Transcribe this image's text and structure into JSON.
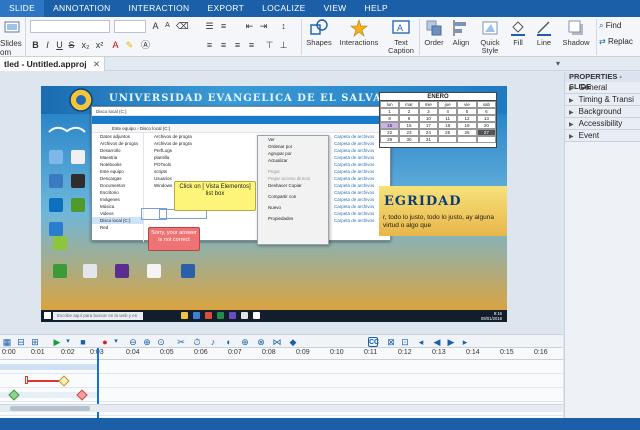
{
  "menu": [
    "SLIDE",
    "ANNOTATION",
    "INTERACTION",
    "EXPORT",
    "LOCALIZE",
    "VIEW",
    "HELP"
  ],
  "ribbon": {
    "left_label": "Slides\nom",
    "tools": {
      "shapes": "Shapes",
      "interactions": "Interactions",
      "text_caption_1": "Text",
      "text_caption_2": "Caption",
      "order": "Order",
      "align": "Align",
      "quick_style_1": "Quick",
      "quick_style_2": "Style",
      "fill": "Fill",
      "line": "Line",
      "shadow": "Shadow",
      "find": "Find",
      "replace": "Replac"
    }
  },
  "document_tab": {
    "title": "tled - Untitled.approj",
    "close": "✕"
  },
  "slide": {
    "banner_title": "UNIVERSIDAD EVANGELICA DE EL SALVADOR",
    "explorer": {
      "title": "Disco local (C:)",
      "address": "Este equipo › Disco local (C:)",
      "sidebar": [
        "Datos adjuntos",
        "Archivos de progra",
        "Desarrollo",
        "Maestria",
        "Notebooks",
        "Este equipo",
        "Descargas",
        "Documentos",
        "Escritorio",
        "Imágenes",
        "Música",
        "Videos",
        "Disco local (C:)",
        "Red"
      ],
      "list": [
        "Archivos de progra",
        "Archivos de progra",
        "PerfLogs",
        "plantilla",
        "POTools",
        "scripts",
        "Usuarios",
        "Windows"
      ],
      "context_menu": [
        "Ver",
        "Ordenar por",
        "Agrupar por",
        "Actualizar",
        "Pegar",
        "Pegar acceso directo",
        "Deshacer Copiar",
        "Compartir con",
        "Nuevo",
        "Propiedades"
      ],
      "context_menu_dim": [
        false,
        false,
        false,
        false,
        true,
        true,
        false,
        false,
        false,
        false
      ],
      "right_col": [
        "Carpeta de archivos",
        "Carpeta de archivos",
        "Carpeta de archivos",
        "Carpeta de archivos",
        "Carpeta de archivos",
        "Carpeta de archivos",
        "Carpeta de archivos",
        "Carpeta de archivos",
        "Carpeta de archivos",
        "Carpeta de archivos",
        "Carpeta de archivos",
        "Carpeta de archivos",
        "Carpeta de archivos"
      ]
    },
    "hint_callout": "Click on [ Vista Elementos] list box",
    "fail_callout": "Sorry, your answer is not correct",
    "calendar": {
      "month": "ENERO",
      "days": [
        "lun",
        "mar",
        "mie",
        "jue",
        "vie",
        "sab"
      ],
      "rows": [
        [
          "1",
          "2",
          "3",
          "4",
          "5",
          "6"
        ],
        [
          "8",
          "9",
          "10",
          "11",
          "12",
          "13"
        ],
        [
          "15",
          "16",
          "17",
          "18",
          "19",
          "20"
        ],
        [
          "22",
          "23",
          "24",
          "25",
          "26",
          "27"
        ],
        [
          "29",
          "30",
          "31",
          "",
          "",
          ""
        ]
      ]
    },
    "values_word": "EGRIDAD",
    "values_text": "r, todo lo justo, todo lo justo, ay alguna virtud o algo que",
    "taskbar_search": "Escribe aquí para buscar en la web y en Windows",
    "clock_time": "9:16",
    "clock_date": "08/01/2018"
  },
  "properties": {
    "title": "PROPERTIES - SLIDE",
    "items": [
      "General",
      "Timing & Transi",
      "Background",
      "Accessibility",
      "Event"
    ]
  },
  "timeline": {
    "ticks": [
      "0:00",
      "0:01",
      "0:02",
      "0:03",
      "0:04",
      "0:05",
      "0:06",
      "0:07",
      "0:08",
      "0:09",
      "0:10",
      "0:11",
      "0:12",
      "0:13",
      "0:14",
      "0:15",
      "0:16"
    ]
  },
  "colors": {
    "menubar": "#1a5fa8",
    "accent": "#1a6fe0",
    "hint_callout": "#fdf57a",
    "fail_callout": "#f07373"
  }
}
